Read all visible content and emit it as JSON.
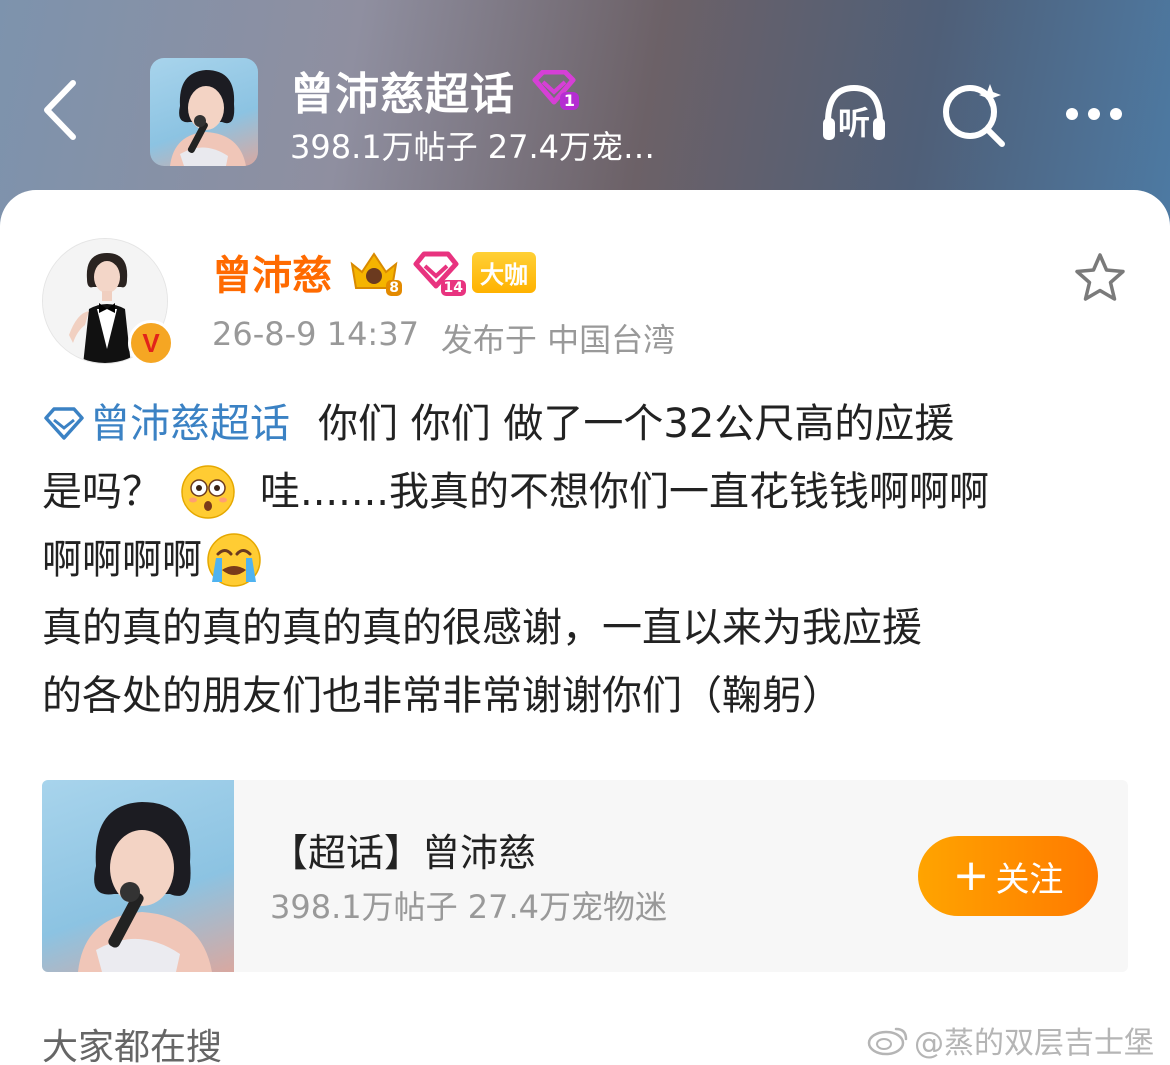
{
  "header": {
    "supertopic_title": "曾沛慈超话",
    "supertopic_level": "1",
    "stats": "398.1万帖子 27.4万宠…",
    "listen_label": "听"
  },
  "post": {
    "author": "曾沛慈",
    "fan_level": "14",
    "crown_level": "8",
    "badge": "大咖",
    "verified_mark": "V",
    "time": "26-8-9 14:37",
    "location": "发布于 中国台湾",
    "topic_link": "曾沛慈超话",
    "line1": "你们 你们 做了一个32公尺高的应援",
    "line2_a": "是吗？",
    "line2_b": "哇.......我真的不想你们一直花钱钱啊啊啊",
    "line3": "啊啊啊啊",
    "line4": "真的真的真的真的真的很感谢，一直以来为我应援",
    "line5": "的各处的朋友们也非常非常谢谢你们（鞠躬）"
  },
  "topic_card": {
    "name": "【超话】曾沛慈",
    "stats": "398.1万帖子 27.4万宠物迷",
    "follow_label": "关注",
    "follow_plus": "+"
  },
  "section": {
    "title": "大家都在搜"
  },
  "watermark": {
    "text": "@蒸的双层吉士堡"
  },
  "colors": {
    "author_orange": "#ff6a00",
    "link_blue": "#3b82c4",
    "follow_gradient_start": "#ffa400",
    "follow_gradient_end": "#ff7a00",
    "meta_gray": "#999999"
  }
}
